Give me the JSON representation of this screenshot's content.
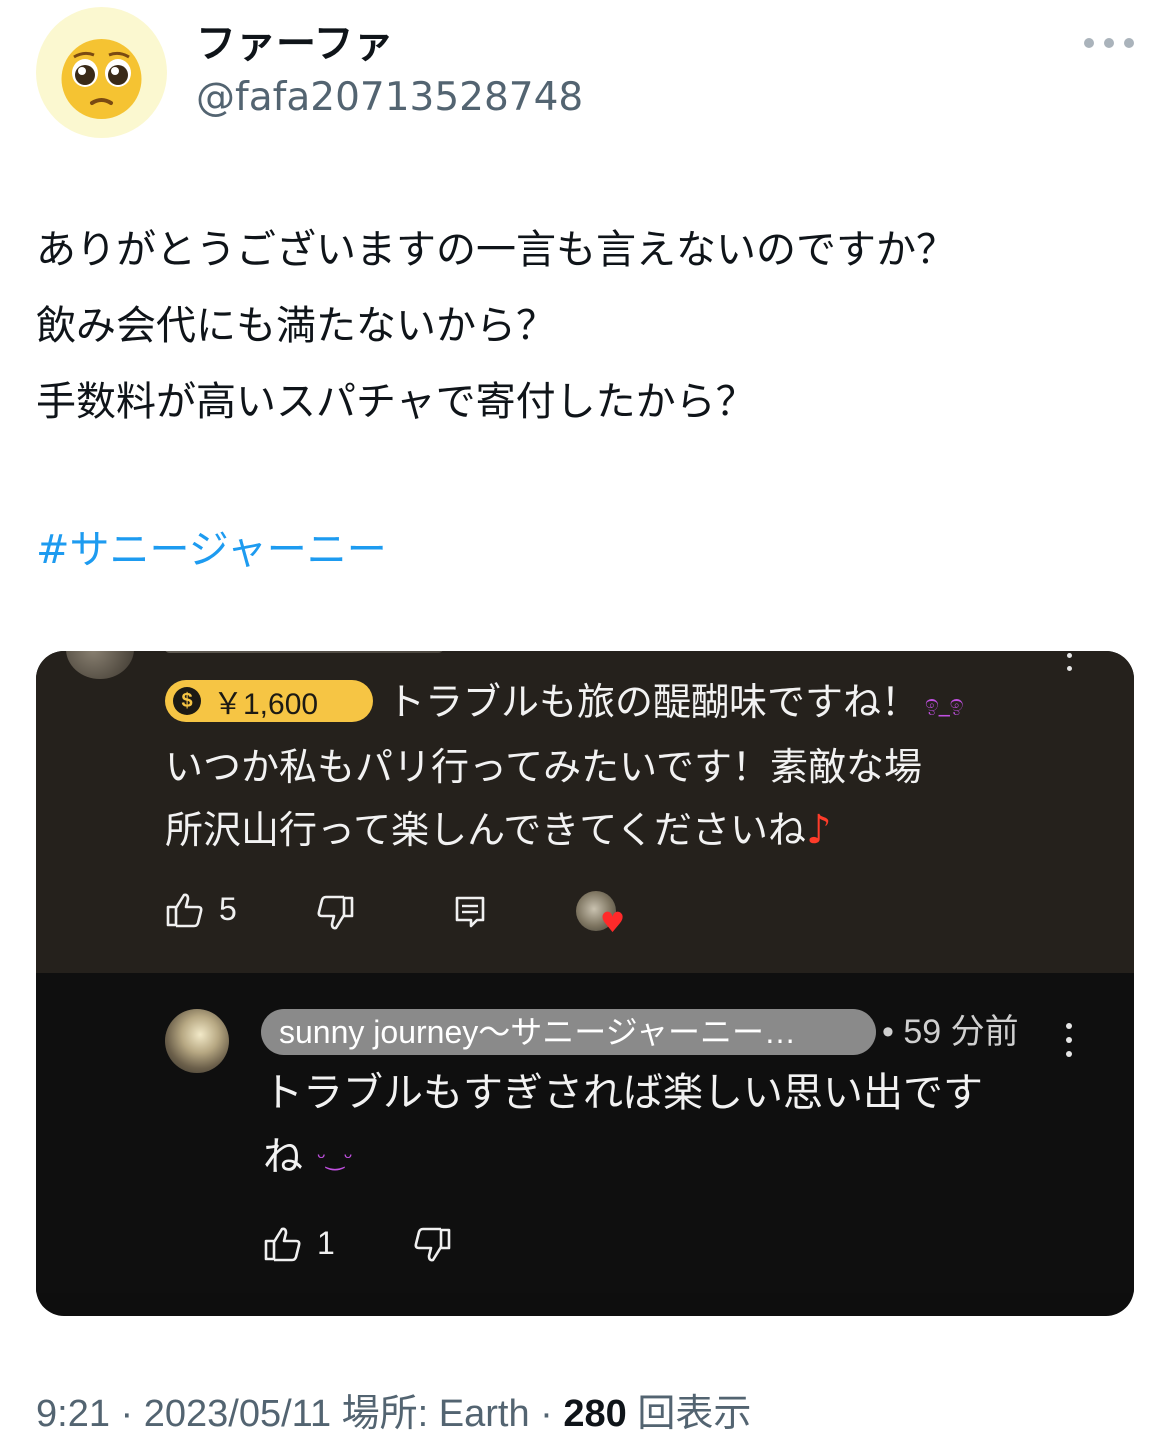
{
  "tweet": {
    "display_name": "ファーファ",
    "handle": "@fafa20713528748",
    "avatar_emoji": "pleading-face",
    "text_lines": [
      "ありがとうございますの一言も言えないのですか？",
      "飲み会代にも満たないから？",
      "手数料が高いスパチャで寄付したから？"
    ],
    "hashtag": "#サニージャーニー",
    "more_icon": "more-horizontal-icon"
  },
  "screenshot": {
    "superchat": {
      "amount": "￥1,600",
      "coin_symbol": "$"
    },
    "comment": {
      "line1": "トラブルも旅の醍醐味ですね！",
      "line2": "いつか私もパリ行ってみたいです！素敵な場",
      "line3": "所沢山行って楽しんできてくださいね",
      "note_symbol": "♪",
      "emoji_symbol": "ඉ_ඉ",
      "like_count": "5"
    },
    "reply": {
      "channel": "sunny journey〜サニージャーニー…",
      "time": "• 59 分前",
      "line1": "トラブルもすぎされば楽しい思い出です",
      "line2": "ね",
      "emoji_symbol": "ᵕ‿ᵕ",
      "like_count": "1"
    }
  },
  "footer": {
    "time": "9:21",
    "sep1": " · ",
    "date": "2023/05/11",
    "location": " 場所: Earth",
    "sep2": " · ",
    "views": "280",
    "views_label": " 回表示"
  },
  "colors": {
    "link": "#1d9bf0",
    "secondary": "#536471",
    "superchat_gold": "#f6c544",
    "comment_bg": "#25211c",
    "reply_bg": "#0f0f0f"
  }
}
